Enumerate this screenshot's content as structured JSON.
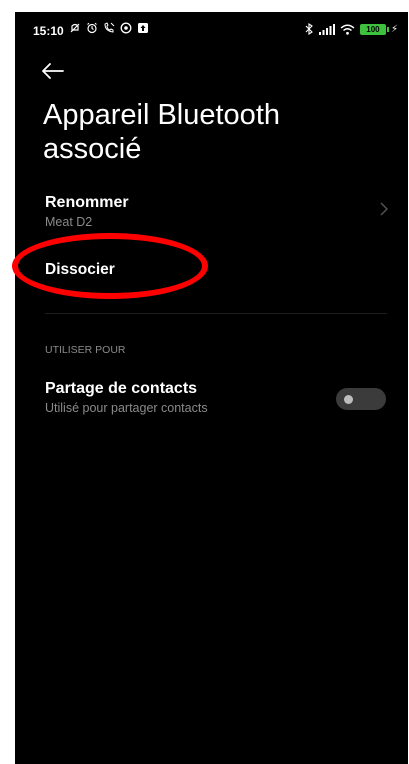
{
  "status_bar": {
    "time": "15:10",
    "left_icons": [
      "mute-icon",
      "alarm-icon",
      "phone-off-icon",
      "vpn-icon",
      "upload-icon"
    ],
    "right_icons": [
      "bluetooth-icon",
      "signal-icon",
      "wifi-icon",
      "battery-icon"
    ],
    "battery_level": "100",
    "charging": true
  },
  "header": {
    "title": "Appareil Bluetooth associé"
  },
  "rows": {
    "rename": {
      "title": "Renommer",
      "subtitle": "Meat D2"
    },
    "unpair": {
      "title": "Dissocier"
    }
  },
  "section": {
    "label": "UTILISER POUR"
  },
  "contacts": {
    "title": "Partage de contacts",
    "subtitle": "Utilisé pour partager contacts",
    "enabled": false
  },
  "colors": {
    "background": "#000000",
    "annotation": "#ff0000",
    "battery": "#3ec23e",
    "secondary_text": "#8a8a8a"
  }
}
